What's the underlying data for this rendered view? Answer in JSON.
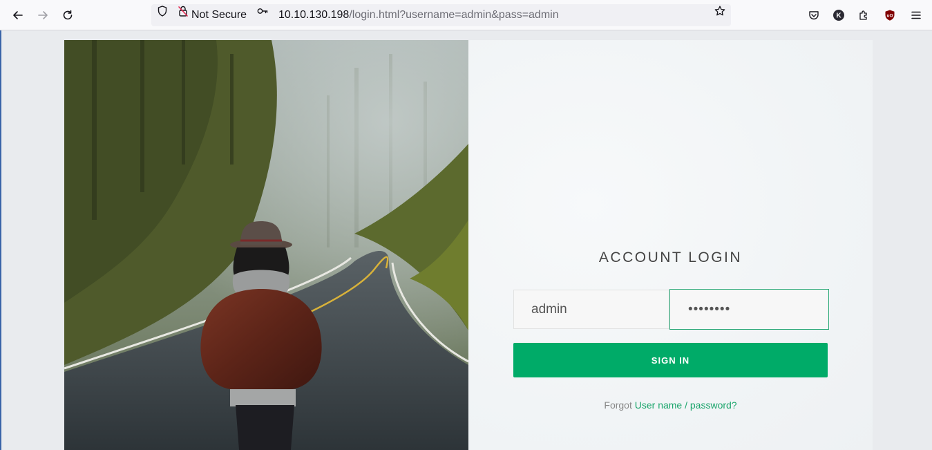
{
  "browser": {
    "security_label": "Not Secure",
    "url_host": "10.10.130.198",
    "url_path": "/login.html?username=admin&pass=admin",
    "profile_initial": "K",
    "ublock_badge": "uO",
    "icons": [
      "back-arrow-icon",
      "forward-arrow-icon",
      "reload-icon",
      "shield-icon",
      "insecure-lock-icon",
      "key-icon",
      "bookmark-star-icon",
      "pocket-icon",
      "account-icon",
      "extensions-icon",
      "ublock-icon",
      "menu-icon"
    ]
  },
  "login": {
    "title": "ACCOUNT LOGIN",
    "username_value": "admin",
    "password_value": "admin123",
    "signin_label": "SIGN IN",
    "forgot_prefix": "Forgot",
    "forgot_link": "User name / password?"
  },
  "colors": {
    "accent": "#00ab68",
    "link": "#1aa56b"
  }
}
